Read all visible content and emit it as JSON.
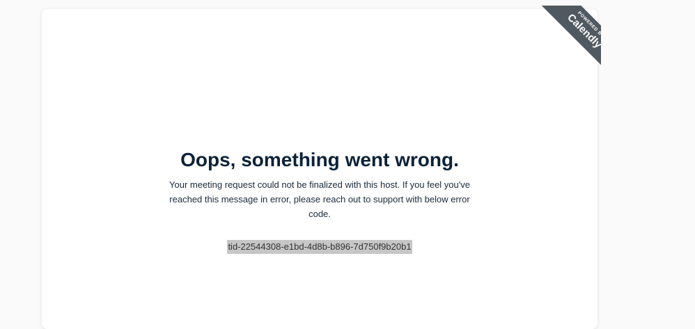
{
  "badge": {
    "powered_by": "POWERED BY",
    "brand": "Calendly"
  },
  "error": {
    "title": "Oops, something went wrong.",
    "message": "Your meeting request could not be finalized with this host. If you feel you've reached this message in error, please reach out to support with below error code.",
    "code": "tid-22544308-e1bd-4d8b-b896-7d750f9b20b1"
  },
  "colors": {
    "page_background": "#fafafa",
    "card_background": "#ffffff",
    "title": "#0b2239",
    "ribbon": "#505960",
    "selection_highlight": "#c6c6c6"
  }
}
